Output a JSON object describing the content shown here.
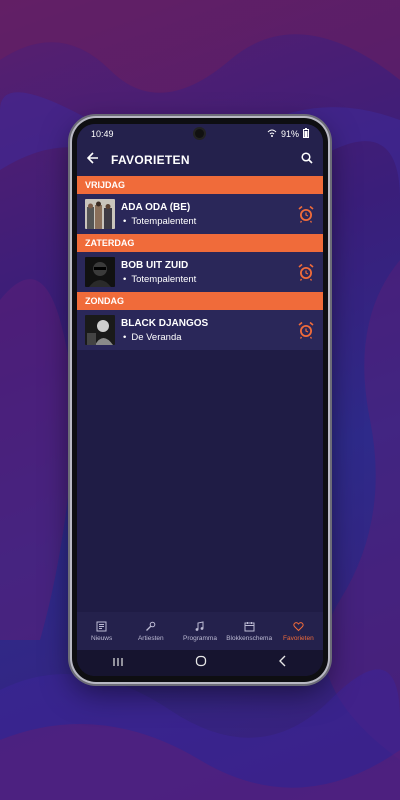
{
  "status": {
    "time": "10:49",
    "battery": "91%"
  },
  "appbar": {
    "title": "FAVORIETEN"
  },
  "days": [
    {
      "label": "VRIJDAG",
      "artist": "ADA ODA (BE)",
      "stage": "Totempalentent"
    },
    {
      "label": "ZATERDAG",
      "artist": "BOB UIT ZUID",
      "stage": "Totempalentent"
    },
    {
      "label": "ZONDAG",
      "artist": "BLACK DJANGOS",
      "stage": "De Veranda"
    }
  ],
  "nav": [
    {
      "label": "Nieuws",
      "icon": "news-icon"
    },
    {
      "label": "Artiesten",
      "icon": "microphone-icon"
    },
    {
      "label": "Programma",
      "icon": "music-note-icon"
    },
    {
      "label": "Blokkenschema",
      "icon": "calendar-icon"
    },
    {
      "label": "Favorieten",
      "icon": "heart-icon"
    }
  ],
  "colors": {
    "accent": "#f06b3a",
    "background": "#1f1c45",
    "row": "#2a2759"
  }
}
